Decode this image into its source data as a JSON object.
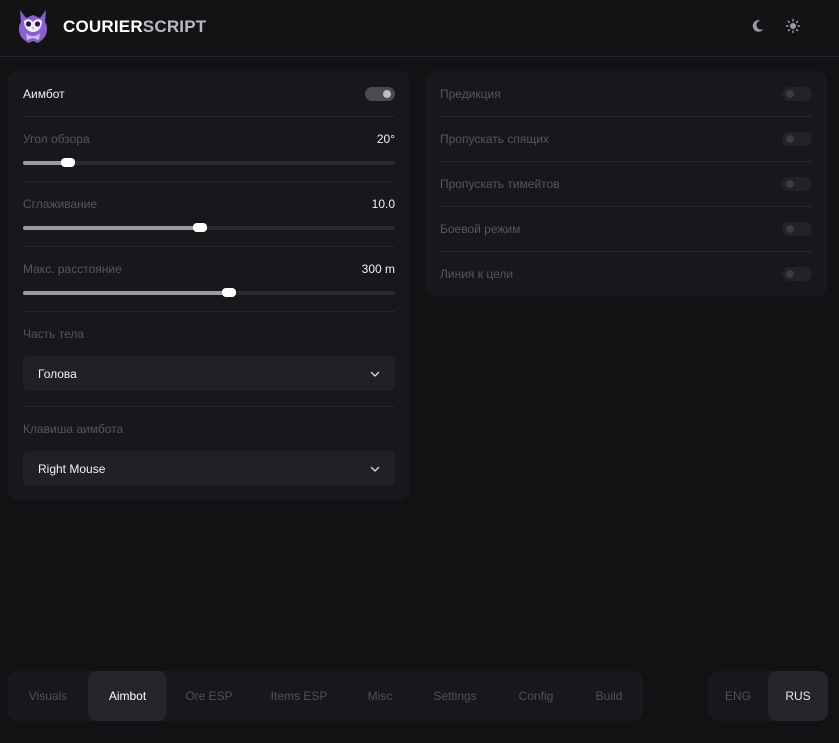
{
  "header": {
    "brand_part1": "COURIER",
    "brand_part2": "SCRIPT"
  },
  "aimbot": {
    "label": "Аимбот",
    "enabled": true
  },
  "fov": {
    "label": "Угол обзора",
    "value_text": "20°",
    "fraction": 0.12
  },
  "smoothing": {
    "label": "Сглаживание",
    "value_text": "10.0",
    "fraction": 0.475
  },
  "max_distance": {
    "label": "Макс. расстояние",
    "value_text": "300 m",
    "fraction": 0.555
  },
  "body_part": {
    "label": "Часть тела",
    "selected": "Голова"
  },
  "aim_key": {
    "label": "Клавиша аимбота",
    "selected": "Right Mouse"
  },
  "right_options": [
    {
      "label": "Предикция",
      "enabled": false
    },
    {
      "label": "Пропускать спящих",
      "enabled": false
    },
    {
      "label": "Пропускать тимейтов",
      "enabled": false
    },
    {
      "label": "Боевой режим",
      "enabled": false
    },
    {
      "label": "Линия к цели",
      "enabled": false
    }
  ],
  "tabs": [
    {
      "label": "Visuals",
      "active": false
    },
    {
      "label": "Aimbot",
      "active": true
    },
    {
      "label": "Ore ESP",
      "active": false
    },
    {
      "label": "Items ESP",
      "active": false
    },
    {
      "label": "Misc",
      "active": false
    },
    {
      "label": "Settings",
      "active": false
    },
    {
      "label": "Config",
      "active": false
    },
    {
      "label": "Build",
      "active": false
    }
  ],
  "languages": [
    {
      "label": "ENG",
      "active": false
    },
    {
      "label": "RUS",
      "active": true
    }
  ],
  "colors": {
    "background": "#121215",
    "panel": "#18181c",
    "active_tab": "#25252c",
    "logo_purple": "#8a5fd0"
  }
}
